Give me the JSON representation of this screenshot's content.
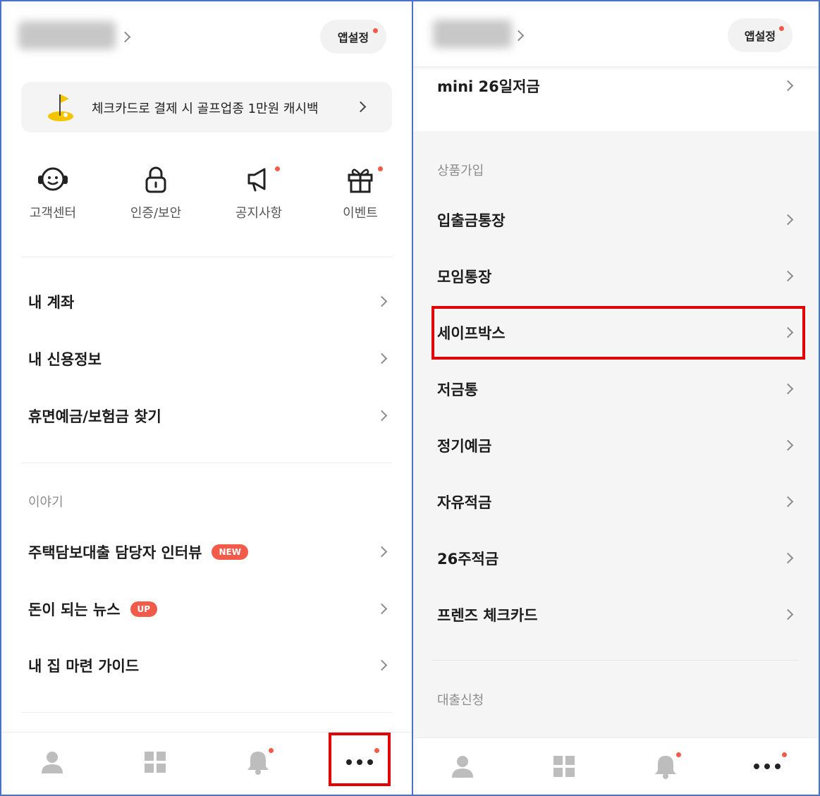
{
  "left_panel": {
    "header": {
      "settings_label": "앱설정"
    },
    "banner": {
      "text": "체크카드로 결제 시 골프업종 1만원 캐시백"
    },
    "quick_menu": [
      {
        "label": "고객센터",
        "icon": "headset-smile-icon"
      },
      {
        "label": "인증/보안",
        "icon": "lock-icon"
      },
      {
        "label": "공지사항",
        "icon": "megaphone-icon"
      },
      {
        "label": "이벤트",
        "icon": "gift-icon"
      }
    ],
    "account_menu": [
      {
        "label": "내 계좌"
      },
      {
        "label": "내 신용정보"
      },
      {
        "label": "휴면예금/보험금 찾기"
      }
    ],
    "story_section": {
      "title": "이야기",
      "items": [
        {
          "label": "주택담보대출 담당자 인터뷰",
          "badge": "NEW"
        },
        {
          "label": "돈이 되는 뉴스",
          "badge": "UP"
        },
        {
          "label": "내 집 마련 가이드"
        }
      ]
    }
  },
  "right_panel": {
    "header": {
      "settings_label": "앱설정"
    },
    "top_item": {
      "label": "mini 26일저금"
    },
    "products_section": {
      "title": "상품가입",
      "items": [
        {
          "label": "입출금통장"
        },
        {
          "label": "모임통장"
        },
        {
          "label": "세이프박스"
        },
        {
          "label": "저금통"
        },
        {
          "label": "정기예금"
        },
        {
          "label": "자유적금"
        },
        {
          "label": "26주적금"
        },
        {
          "label": "프렌즈 체크카드"
        }
      ]
    },
    "loan_section": {
      "title": "대출신청"
    }
  },
  "bottom_nav": [
    "person-icon",
    "grid-icon",
    "bell-icon",
    "more-dots-icon"
  ],
  "colors": {
    "accent_red": "#f25a4a",
    "highlight_red": "#e50000",
    "frame_blue": "#4b72c9",
    "banner_bg": "#f4f4f4",
    "section_bg": "#f5f5f5"
  }
}
